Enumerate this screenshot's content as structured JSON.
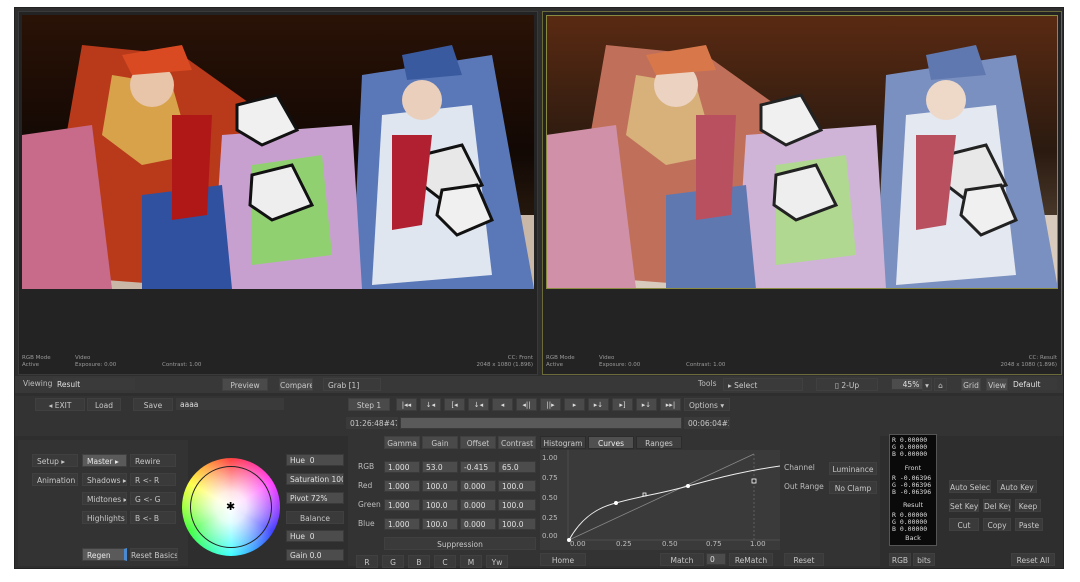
{
  "viewers": {
    "left": {
      "mode_label": "RGB Mode",
      "mode_value": "Active",
      "src_label": "Video",
      "exposure": "Exposure: 0.00",
      "contrast": "Contrast: 1.00",
      "cc_label": "CC: Front",
      "resolution": "2048 x 1080 (1.896)"
    },
    "right": {
      "mode_label": "RGB Mode",
      "mode_value": "Active",
      "src_label": "Video",
      "exposure": "Exposure: 0.00",
      "contrast": "Contrast: 1.00",
      "cc_label": "CC: Result",
      "resolution": "2048 x 1080 (1.896)"
    }
  },
  "viewing_bar": {
    "viewing_label": "Viewing",
    "viewing_value": "Result",
    "preview": "Preview",
    "compare": "Compare",
    "grab": "Grab [1]",
    "tools_label": "Tools",
    "select": "Select",
    "layout": "2-Up",
    "zoom": "45%",
    "grid": "Grid",
    "view": "View",
    "view_value": "Default"
  },
  "transport": {
    "exit": "EXIT",
    "load": "Load",
    "save": "Save",
    "name": "aaaa",
    "step": "Step 1",
    "options": "Options",
    "timecode_in": "01:26:48#47",
    "timecode_out": "00:06:04#25"
  },
  "left_panel": {
    "setup": "Setup",
    "animation": "Animation",
    "master": "Master",
    "shadows": "Shadows",
    "midtones": "Midtones",
    "highlights": "Highlights",
    "rewire": "Rewire",
    "r_r": "R <- R",
    "g_g": "G <- G",
    "b_b": "B <- B",
    "regen": "Regen",
    "reset_basics": "Reset Basics"
  },
  "hue_panel": {
    "hue": "Hue",
    "hue_val": "0",
    "saturation": "Saturation",
    "saturation_val": "100",
    "pivot": "Pivot",
    "pivot_val": "72%",
    "balance": "Balance",
    "hue2": "Hue",
    "hue2_val": "0",
    "gain": "Gain",
    "gain_val": "0.0"
  },
  "grade_table": {
    "headers": [
      "Gamma",
      "Gain",
      "Offset",
      "Contrast"
    ],
    "rows": [
      {
        "label": "RGB",
        "values": [
          "1.000",
          "53.0",
          "-0.415",
          "65.0"
        ]
      },
      {
        "label": "Red",
        "values": [
          "1.000",
          "100.0",
          "0.000",
          "100.0"
        ]
      },
      {
        "label": "Green",
        "values": [
          "1.000",
          "100.0",
          "0.000",
          "100.0"
        ]
      },
      {
        "label": "Blue",
        "values": [
          "1.000",
          "100.0",
          "0.000",
          "100.0"
        ]
      }
    ],
    "suppression": "Suppression",
    "channels": [
      "R",
      "G",
      "B",
      "C",
      "M",
      "Yw"
    ]
  },
  "curves": {
    "tabs": [
      "Histogram",
      "Curves",
      "Ranges"
    ],
    "y_ticks": [
      "1.00",
      "0.75",
      "0.50",
      "0.25",
      "0.00"
    ],
    "x_ticks": [
      "0.00",
      "0.25",
      "0.50",
      "0.75",
      "1.00"
    ],
    "channel_label": "Channel",
    "channel_value": "Luminance",
    "out_range_label": "Out Range",
    "out_range_value": "No Clamp",
    "home": "Home",
    "match": "Match",
    "match_val": "0",
    "rematch": "ReMatch",
    "reset": "Reset"
  },
  "readout": {
    "top": [
      "R  0.00000",
      "G  0.00000",
      "B  0.00000"
    ],
    "front_label": "Front",
    "front": [
      "R -0.06396",
      "G -0.06396",
      "B -0.06396"
    ],
    "result_label": "Result",
    "result": [
      "R  0.00000",
      "G  0.00000",
      "B  0.00000"
    ],
    "back_label": "Back",
    "rgb": "RGB",
    "bits": "bits"
  },
  "key_panel": {
    "auto_select": "Auto Select",
    "auto_key": "Auto Key",
    "set_key": "Set Key",
    "del_key": "Del Key",
    "keep": "Keep",
    "cut": "Cut",
    "copy": "Copy",
    "paste": "Paste",
    "reset_all": "Reset All"
  }
}
